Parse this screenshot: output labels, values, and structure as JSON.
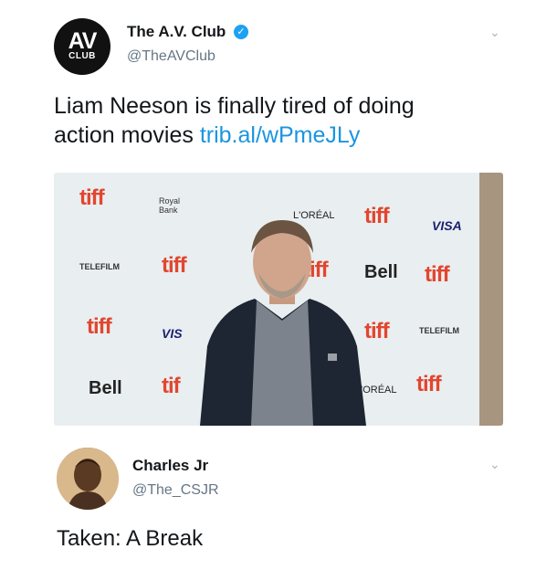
{
  "tweet1": {
    "avatar_main": "AV",
    "avatar_sub": "CLUB",
    "name": "The A.V. Club",
    "handle": "@TheAVClub",
    "text_line1": "Liam Neeson is finally tired of doing",
    "text_line2": "action movies",
    "link": "trib.al/wPmeJLy",
    "photo_logos": {
      "tiff": "tiff",
      "royal": "Royal Bank",
      "loreal": "L'ORÉAL",
      "visa": "VISA",
      "visa_partial": "VIS",
      "bell": "Bell",
      "telefilm": "TELEFILM",
      "tiff_partial": "tif"
    }
  },
  "tweet2": {
    "name": "Charles Jr",
    "handle": "@The_CSJR",
    "text": "Taken: A Break"
  },
  "colors": {
    "link": "#1b95e0",
    "verified": "#1da1f2",
    "tiff": "#e2462f"
  }
}
